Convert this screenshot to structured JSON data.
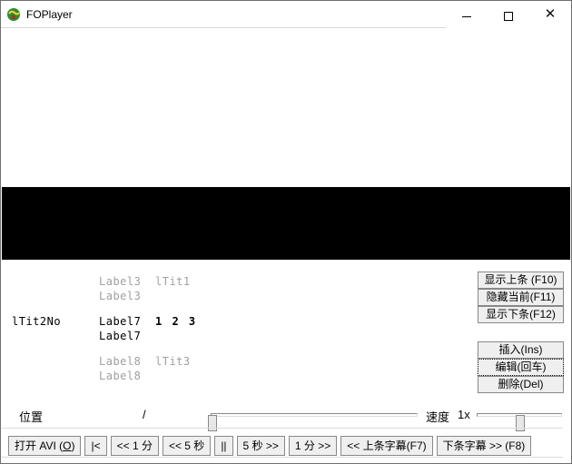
{
  "window": {
    "title": "FOPlayer"
  },
  "labels": {
    "row1a": "Label3",
    "row1b": "lTit1",
    "row2a": "Label3",
    "rowL": "lTit2No",
    "row3a": "Label7",
    "row3b": "1 2 3",
    "row4a": "Label7",
    "row5a": "Label8",
    "row5b": "lTit3",
    "row6a": "Label8"
  },
  "right_buttons": {
    "show_prev": "显示上条 (F10)",
    "hide_curr": "隐藏当前(F11)",
    "show_next": "显示下条(F12)",
    "insert": "插入(Ins)",
    "edit": "编辑(回车)",
    "delete": "删除(Del)"
  },
  "status": {
    "pos_label": "位置",
    "slash": "/",
    "speed_label": "速度",
    "speed_value": "1x"
  },
  "bottom": {
    "open_avi_pre": "打开 AVI (",
    "open_avi_key": "O",
    "open_avi_post": ")",
    "seek_start": "|<",
    "back1m": "<< 1 分",
    "back5s": "<< 5 秒",
    "pause": "||",
    "fwd5s": "5 秒 >>",
    "fwd1m": "1 分 >>",
    "prev_sub": "<< 上条字幕(F7)",
    "next_sub": "下条字幕 >> (F8)"
  }
}
